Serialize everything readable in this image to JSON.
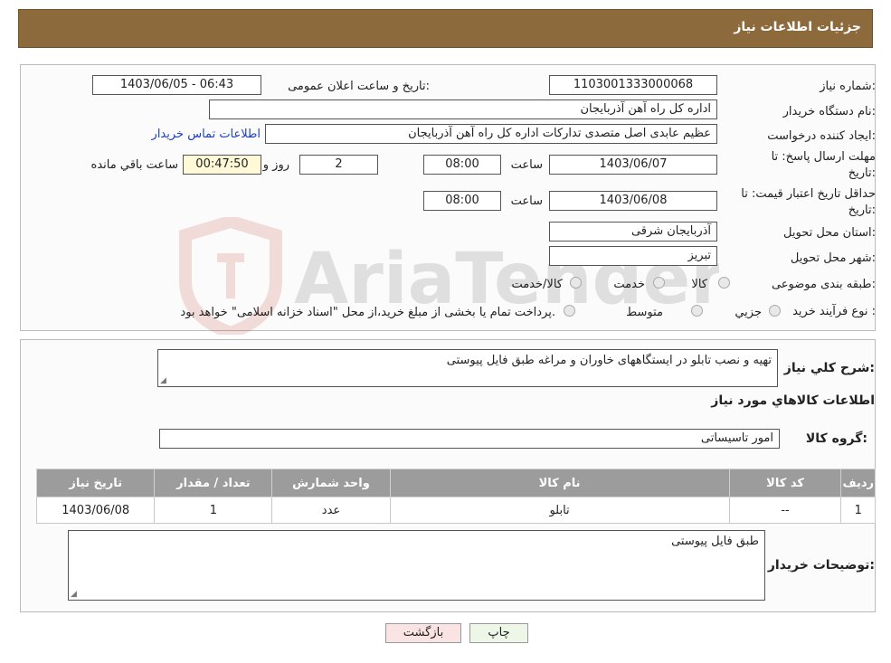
{
  "header": {
    "title": "جزئیات اطلاعات نیاز"
  },
  "form": {
    "need_number_label": "شماره نیاز:",
    "need_number": "1103001333000068",
    "announce_label": "تاریخ و ساعت اعلان عمومی:",
    "announce_value": "1403/06/05 - 06:43",
    "buyer_org_label": "نام دستگاه خریدار:",
    "buyer_org": "اداره کل راه آهن آذربایجان",
    "creator_label": "ایجاد کننده درخواست:",
    "creator": "عظیم عابدی اصل متصدی تدارکات اداره کل راه آهن آذربایجان",
    "contact_link": "اطلاعات تماس خریدار",
    "deadline_label_1": "مهلت ارسال پاسخ: تا",
    "deadline_label_2": "تاریخ:",
    "deadline_date": "1403/06/07",
    "time_label": "ساعت",
    "deadline_time": "08:00",
    "days": "2",
    "days_label": "روز و",
    "remaining": "00:47:50",
    "remaining_label": "ساعت باقي مانده",
    "validity_label_1": "حداقل تاریخ اعتبار قیمت: تا",
    "validity_label_2": "تاریخ:",
    "validity_date": "1403/06/08",
    "validity_time": "08:00",
    "province_label": "استان محل تحویل:",
    "province": "آذربایجان شرقی",
    "city_label": "شهر محل تحویل:",
    "city": "تبریز",
    "category_label": "طبقه بندی موضوعی:",
    "category_options": [
      "کالا",
      "خدمت",
      "کالا/خدمت"
    ],
    "process_label": "نوع فرآیند خرید :",
    "process_options": [
      "جزیي",
      "متوسط"
    ],
    "process_note": "پرداخت تمام یا بخشی از مبلغ خرید،از محل \"اسناد خزانه اسلامی\" خواهد بود."
  },
  "details": {
    "summary_label": "شرح کلي نياز:",
    "summary": "تهیه و نصب تابلو در ایستگاههای خاوران و مراغه طبق فایل پیوستی",
    "goods_heading": "اطلاعات کالاهاي مورد نياز",
    "group_label": "گروه کالا:",
    "group": "امور تاسیساتی",
    "table_headers": [
      "رديف",
      "کد کالا",
      "نام کالا",
      "واحد شمارش",
      "تعداد / مقدار",
      "تاريخ نياز"
    ],
    "rows": [
      [
        "1",
        "--",
        "تابلو",
        "عدد",
        "1",
        "1403/06/08"
      ]
    ],
    "buyer_notes_label": "توضيحات خريدار:",
    "buyer_notes": "طبق فایل پیوستی"
  },
  "buttons": {
    "print": "چاپ",
    "back": "بازگشت"
  },
  "watermark": {
    "text": "AriaTender.neT"
  },
  "colors": {
    "header": "#8c6a3b",
    "table_header": "#9c9c9c",
    "link": "#1b3fc2"
  }
}
